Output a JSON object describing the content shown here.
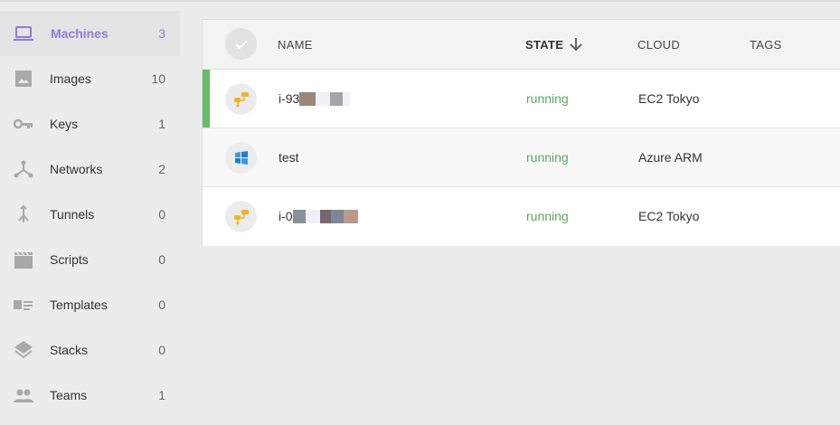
{
  "sidebar": {
    "items": [
      {
        "label": "Machines",
        "count": "3"
      },
      {
        "label": "Images",
        "count": "10"
      },
      {
        "label": "Keys",
        "count": "1"
      },
      {
        "label": "Networks",
        "count": "2"
      },
      {
        "label": "Tunnels",
        "count": "0"
      },
      {
        "label": "Scripts",
        "count": "0"
      },
      {
        "label": "Templates",
        "count": "0"
      },
      {
        "label": "Stacks",
        "count": "0"
      },
      {
        "label": "Teams",
        "count": "1"
      }
    ],
    "active_color": "#8f7bd6"
  },
  "table": {
    "columns": {
      "name": "NAME",
      "state": "STATE",
      "cloud": "CLOUD",
      "tags": "TAGS"
    },
    "rows": [
      {
        "name": "i-93",
        "state": "running",
        "cloud": "EC2 Tokyo",
        "icon": "aws-icon"
      },
      {
        "name": "test",
        "state": "running",
        "cloud": "Azure ARM",
        "icon": "azure-icon"
      },
      {
        "name": "i-0",
        "state": "running",
        "cloud": "EC2 Tokyo",
        "icon": "aws-icon"
      }
    ],
    "running_color": "#5aa85f",
    "selected_marker_color": "#65bb6a"
  }
}
